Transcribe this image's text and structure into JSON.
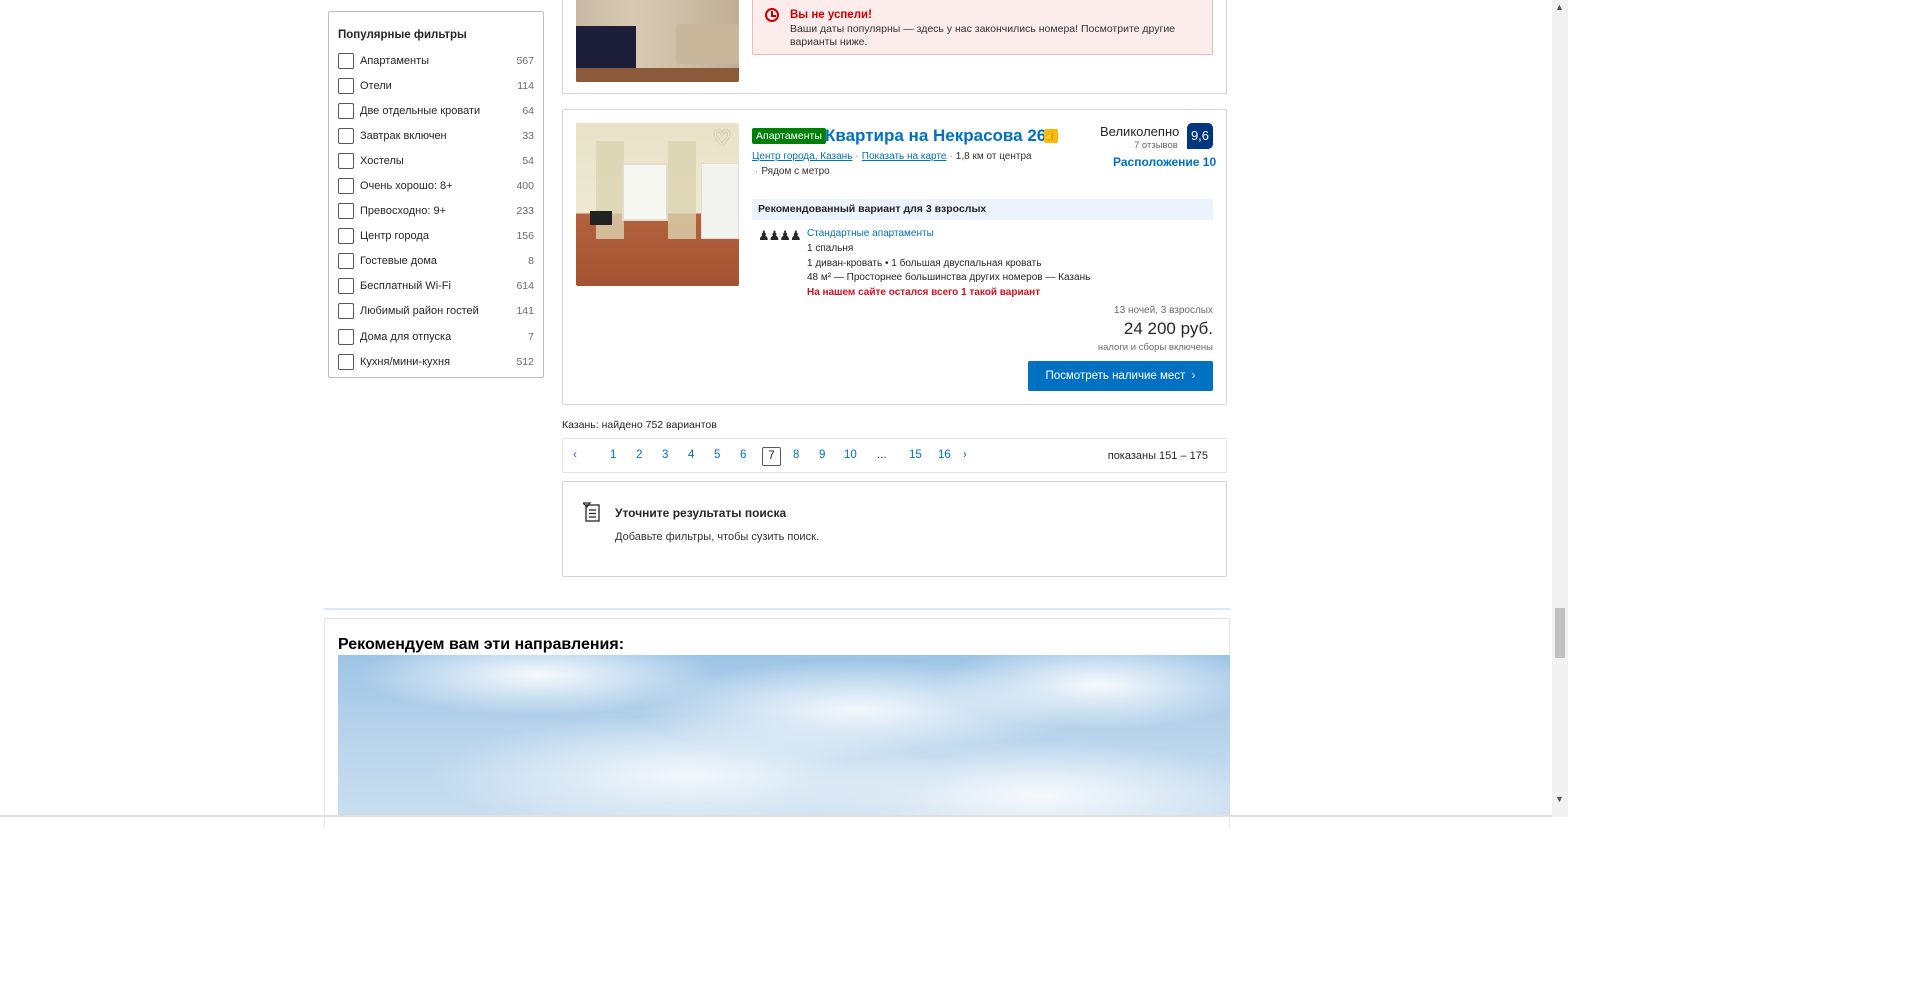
{
  "filters": {
    "title": "Популярные фильтры",
    "items": [
      {
        "label": "Апартаменты",
        "count": "567"
      },
      {
        "label": "Отели",
        "count": "114"
      },
      {
        "label": "Две отдельные кровати",
        "count": "64"
      },
      {
        "label": "Завтрак включен",
        "count": "33"
      },
      {
        "label": "Хостелы",
        "count": "54"
      },
      {
        "label": "Очень хорошо: 8+",
        "count": "400"
      },
      {
        "label": "Превосходно: 9+",
        "count": "233"
      },
      {
        "label": "Центр города",
        "count": "156"
      },
      {
        "label": "Гостевые дома",
        "count": "8"
      },
      {
        "label": "Бесплатный Wi-Fi",
        "count": "614"
      },
      {
        "label": "Любимый район гостей",
        "count": "141"
      },
      {
        "label": "Дома для отпуска",
        "count": "7"
      },
      {
        "label": "Кухня/мини-кухня",
        "count": "512"
      }
    ]
  },
  "sold_out": {
    "title": "Вы не успели!",
    "text": "Ваши даты популярны — здесь у нас закончились номера! Посмотрите другие варианты ниже."
  },
  "property": {
    "badge": "Апартаменты",
    "name": "Квартира на Некрасова 26",
    "location_link": "Центр города, Казань",
    "map_link": "Показать на карте",
    "distance": "1,8 км от центра",
    "metro": "Рядом с метро",
    "score_word": "Великолепно",
    "reviews": "7 отзывов",
    "score": "9,6",
    "location_score": "Расположение 10",
    "recommended": "Рекомендованный вариант для 3 взрослых",
    "unit_type": "Стандартные апартаменты",
    "unit_lines": [
      "1 спальня",
      "1 диван-кровать • 1 большая двуспальная кровать",
      "48 м² — Просторнее большинства других номеров — Казань"
    ],
    "warning": "На нашем сайте остался всего 1 такой вариант",
    "stay": "13 ночей, 3 взрослых",
    "price": "24 200 руб.",
    "taxes": "налоги и сборы включены",
    "button": "Посмотреть наличие мест",
    "colors": {
      "accent": "#0071c2",
      "score_bg": "#003580",
      "badge_bg": "#008009",
      "warning": "#d4111e"
    }
  },
  "results": {
    "found": "Казань: найдено 752 вариантов",
    "pages_before": [
      "1",
      "2",
      "3",
      "4",
      "5",
      "6"
    ],
    "current_page": "7",
    "pages_after": [
      "8",
      "9",
      "10"
    ],
    "ellipsis": "...",
    "pages_end": [
      "15",
      "16"
    ],
    "range": "показаны 151 – 175"
  },
  "refine": {
    "title": "Уточните результаты поиска",
    "text": "Добавьте фильтры, чтобы сузить поиск."
  },
  "recommend": {
    "title": "Рекомендуем вам эти направления:"
  }
}
